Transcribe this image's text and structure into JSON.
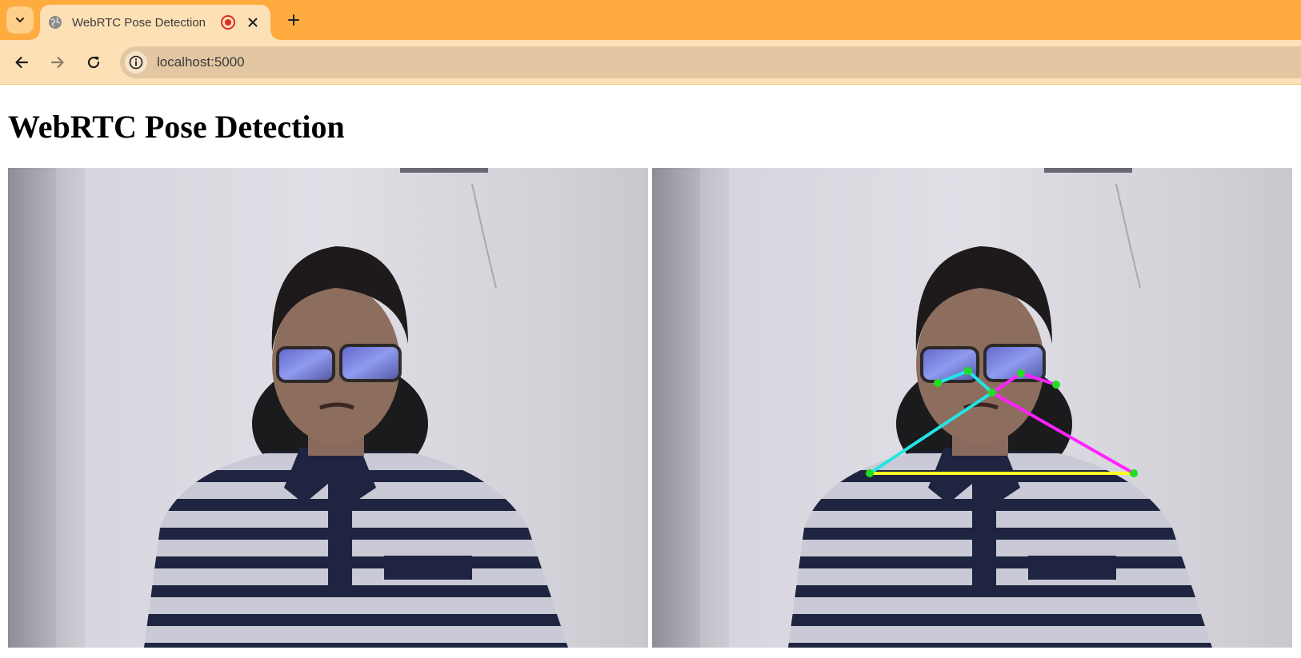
{
  "browser": {
    "tab": {
      "title": "WebRTC Pose Detection",
      "favicon": "globe-icon",
      "recording_indicator": "record-icon"
    },
    "new_tab_icon": "plus-icon",
    "tab_search_icon": "chevron-down-icon",
    "toolbar": {
      "back_icon": "arrow-left-icon",
      "forward_icon": "arrow-right-icon",
      "reload_icon": "reload-icon",
      "site_info_icon": "info-icon",
      "url": "localhost:5000"
    },
    "colors": {
      "frame": "#ffab40",
      "toolbar": "#fde0b6",
      "omnibox": "#e3c7a2"
    }
  },
  "page": {
    "heading": "WebRTC Pose Detection",
    "videos": [
      {
        "name": "local-camera-feed",
        "overlay": false
      },
      {
        "name": "pose-overlay-feed",
        "overlay": true
      }
    ],
    "pose_colors": {
      "keypoint": "#22dd22",
      "right_side": "#22e5e5",
      "left_side": "#ff22ff",
      "shoulder_line": "#ffff22"
    }
  }
}
